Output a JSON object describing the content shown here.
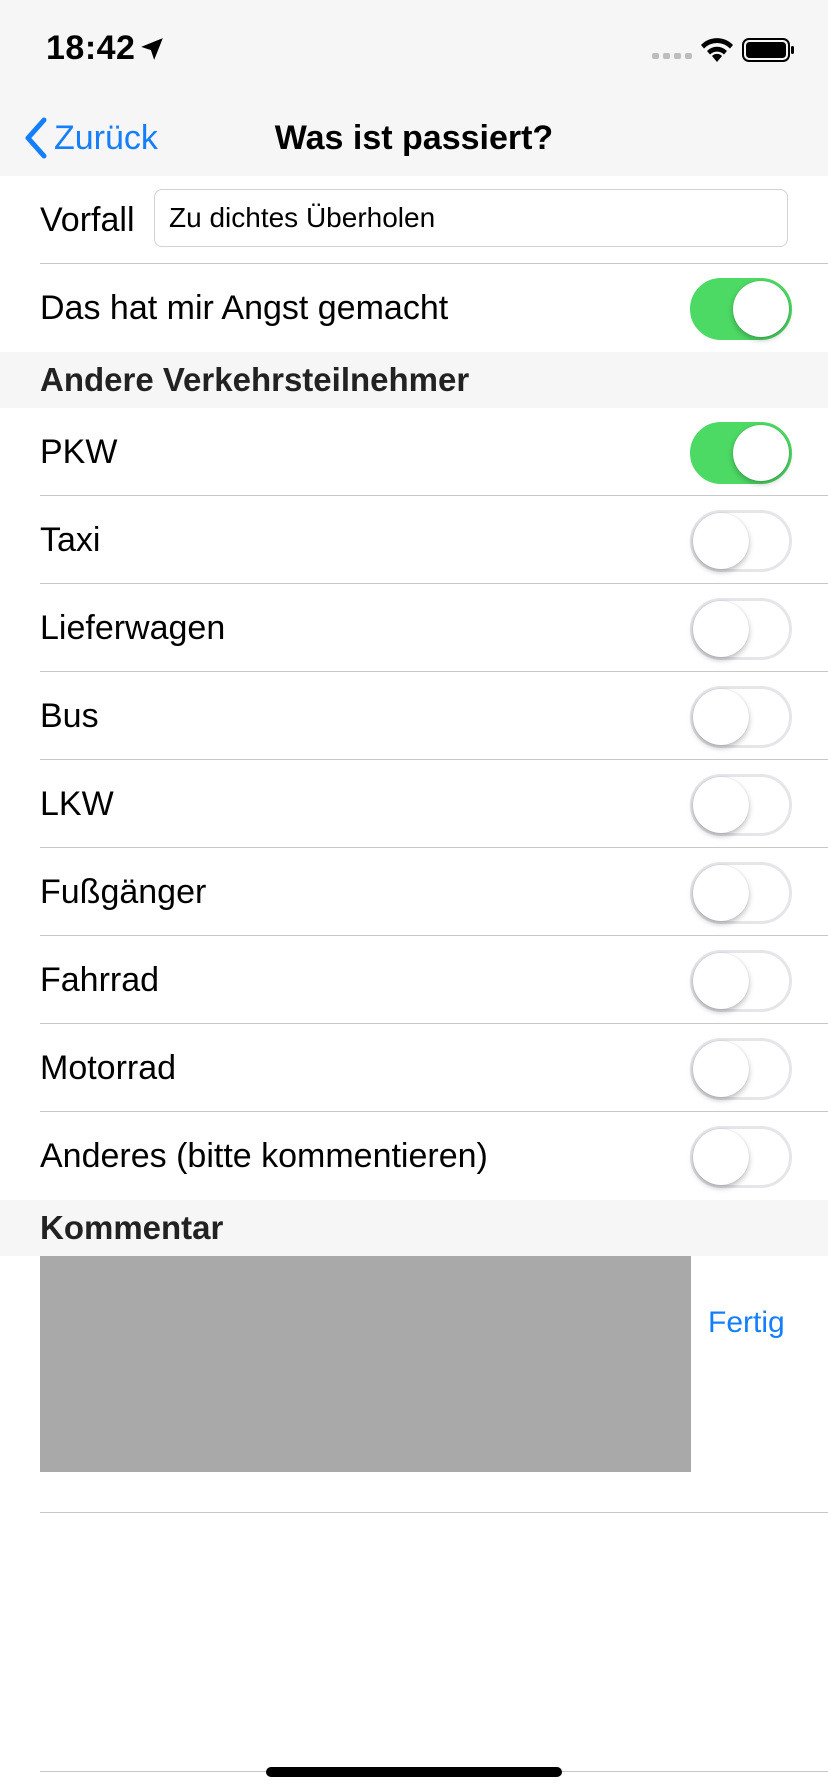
{
  "status_bar": {
    "time": "18:42"
  },
  "nav": {
    "back_label": "Zurück",
    "title": "Was ist passiert?"
  },
  "incident": {
    "label": "Vorfall",
    "value": "Zu dichtes Überholen"
  },
  "scared": {
    "label": "Das hat mir Angst gemacht",
    "on": true
  },
  "others_header": "Andere Verkehrsteilnehmer",
  "participants": [
    {
      "label": "PKW",
      "on": true
    },
    {
      "label": "Taxi",
      "on": false
    },
    {
      "label": "Lieferwagen",
      "on": false
    },
    {
      "label": "Bus",
      "on": false
    },
    {
      "label": "LKW",
      "on": false
    },
    {
      "label": "Fußgänger",
      "on": false
    },
    {
      "label": "Fahrrad",
      "on": false
    },
    {
      "label": "Motorrad",
      "on": false
    },
    {
      "label": "Anderes (bitte kommentieren)",
      "on": false
    }
  ],
  "comment": {
    "header": "Kommentar",
    "done_label": "Fertig"
  },
  "colors": {
    "accent": "#157efb",
    "toggle_on": "#4cd964",
    "toggle_off_border": "#e5e5ea"
  }
}
